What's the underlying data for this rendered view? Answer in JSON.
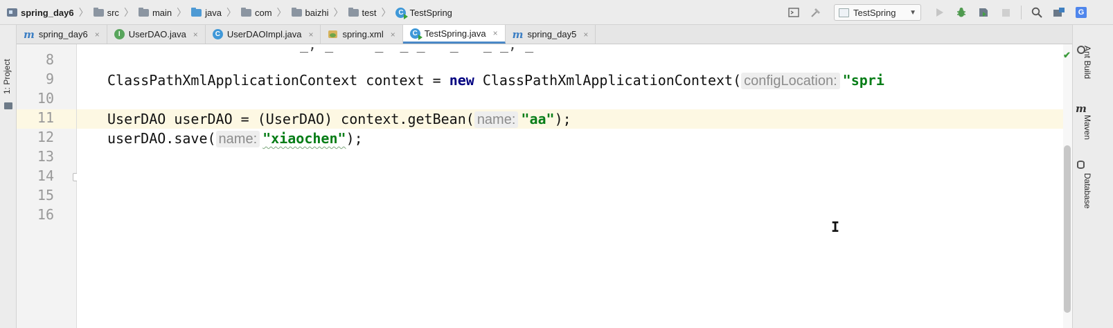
{
  "breadcrumb": {
    "items": [
      {
        "label": "spring_day6",
        "icon": "module-icon"
      },
      {
        "label": "src",
        "icon": "folder-icon"
      },
      {
        "label": "main",
        "icon": "folder-icon"
      },
      {
        "label": "java",
        "icon": "source-folder-icon"
      },
      {
        "label": "com",
        "icon": "package-icon"
      },
      {
        "label": "baizhi",
        "icon": "package-icon"
      },
      {
        "label": "test",
        "icon": "package-icon"
      },
      {
        "label": "TestSpring",
        "icon": "class-icon"
      }
    ]
  },
  "toolbar": {
    "run_config": "TestSpring"
  },
  "tabs": [
    {
      "label": "spring_day6",
      "icon": "maven-icon",
      "active": false
    },
    {
      "label": "UserDAO.java",
      "icon": "interface-icon",
      "active": false
    },
    {
      "label": "UserDAOImpl.java",
      "icon": "class-icon",
      "active": false
    },
    {
      "label": "spring.xml",
      "icon": "xml-icon",
      "active": false
    },
    {
      "label": "TestSpring.java",
      "icon": "class-icon",
      "active": true
    },
    {
      "label": "spring_day5",
      "icon": "maven-icon",
      "active": false
    }
  ],
  "side_panels": {
    "left": "1: Project",
    "right": [
      "Ant Build",
      "Maven",
      "Database"
    ]
  },
  "editor": {
    "line_numbers": [
      "8",
      "9",
      "10",
      "11",
      "12",
      "13",
      "14",
      "15",
      "16"
    ],
    "current_line": "11",
    "top_partial": "_, _     _  _ _   _   _ _, _",
    "line9": {
      "type": "ClassPathXmlApplicationContext",
      "var": " context = ",
      "kw_new": "new",
      "ctor": " ClassPathXmlApplicationContext(",
      "hint": "configLocation:",
      "str": "\"spri"
    },
    "line11": {
      "code": "UserDAO userDAO = (UserDAO) context.getBean(",
      "hint": "name:",
      "str": "\"aa\"",
      "end": ");"
    },
    "line12": {
      "code": "userDAO.save(",
      "hint": "name:",
      "str": "\"xiaochen\"",
      "end": ");"
    }
  }
}
